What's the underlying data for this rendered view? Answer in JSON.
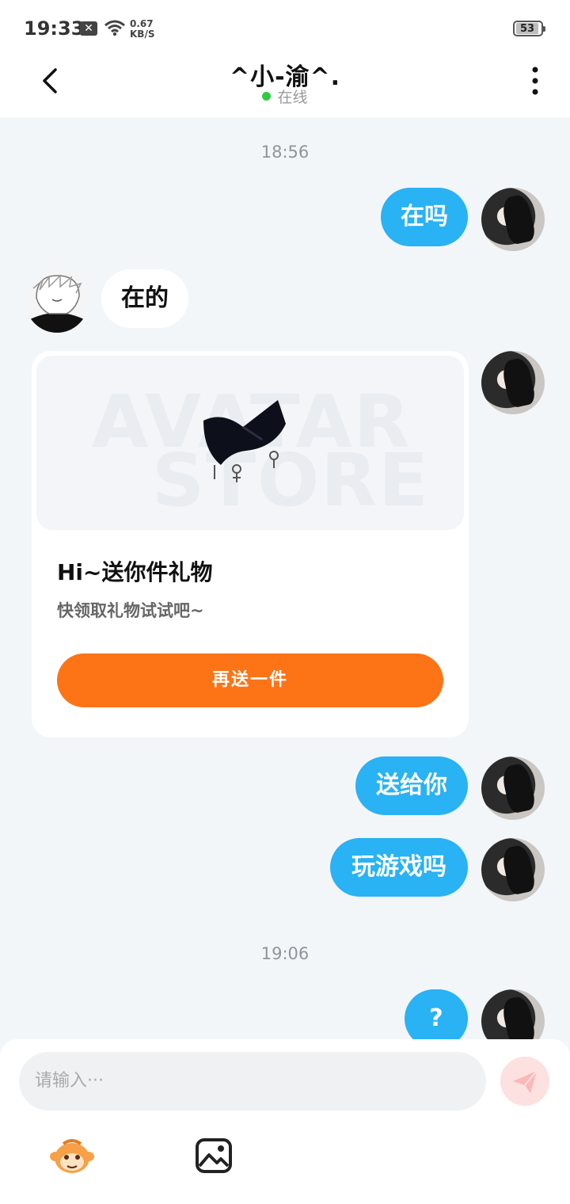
{
  "status_bar": {
    "time": "19:33",
    "notification_badge": "✕",
    "net_speed_value": "0.67",
    "net_speed_unit": "KB/S",
    "battery": "53"
  },
  "header": {
    "title": "^小-渝^.",
    "status": "在线",
    "status_color": "#2ecc40"
  },
  "messages": {
    "time_1": "18:56",
    "m1": "在吗",
    "m2": "在的",
    "gift": {
      "title": "Hi~送你件礼物",
      "subtitle": "快领取礼物试试吧~",
      "button": "再送一件",
      "watermark_line1": "AVATAR",
      "watermark_line2": "STORE"
    },
    "m3": "送给你",
    "m4": "玩游戏吗",
    "time_2": "19:06",
    "m5": "?"
  },
  "input": {
    "placeholder": "请输入···"
  },
  "colors": {
    "bubble_me": "#29b2f4",
    "gift_button": "#fc7416",
    "background": "#f3f6f9"
  },
  "icons": [
    "back-icon",
    "more-icon",
    "wifi-icon",
    "send-icon",
    "emoji-icon",
    "image-icon"
  ]
}
